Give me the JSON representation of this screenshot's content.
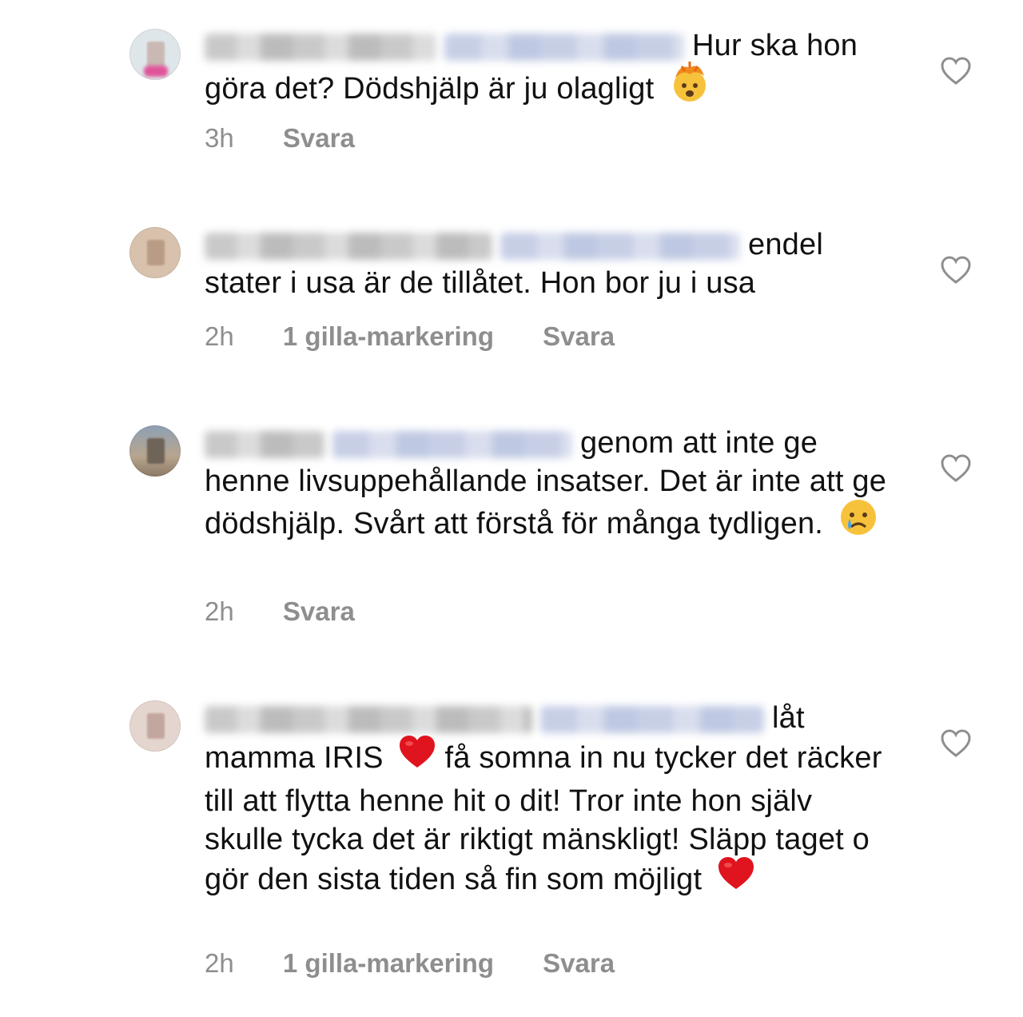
{
  "comments": [
    {
      "text": "Hur ska hon göra det? Dödshjälp är ju olagligt",
      "emoji_icon": "exploding-head-emoji",
      "time": "3h",
      "likes": "",
      "reply": "Svara"
    },
    {
      "text": "endel stater i usa är de tillåtet. Hon bor ju i usa",
      "time": "2h",
      "likes": "1 gilla-markering",
      "reply": "Svara"
    },
    {
      "text": "genom att inte ge henne livsuppehållande insatser. Det är inte att ge dödshjälp. Svårt att förstå för många tydligen.",
      "emoji_icon": "crying-face-emoji",
      "time": "2h",
      "likes": "",
      "reply": "Svara"
    },
    {
      "text_part1": "låt mamma IRIS",
      "text_part2": "få somna in nu  tycker det räcker till att flytta henne hit o dit! Tror inte hon själv skulle tycka det är riktigt mänskligt! Släpp taget o gör den sista tiden så fin som möjligt",
      "emoji_icon": "red-heart-emoji",
      "time": "2h",
      "likes": "1 gilla-markering",
      "reply": "Svara"
    }
  ],
  "icons": {
    "like": "heart-outline-icon",
    "avatar": "blurred-avatar"
  },
  "colors": {
    "meta_text": "#8e8e8e",
    "heart_outline": "#8e8e8e",
    "emoji_heart": "#e0141e"
  }
}
